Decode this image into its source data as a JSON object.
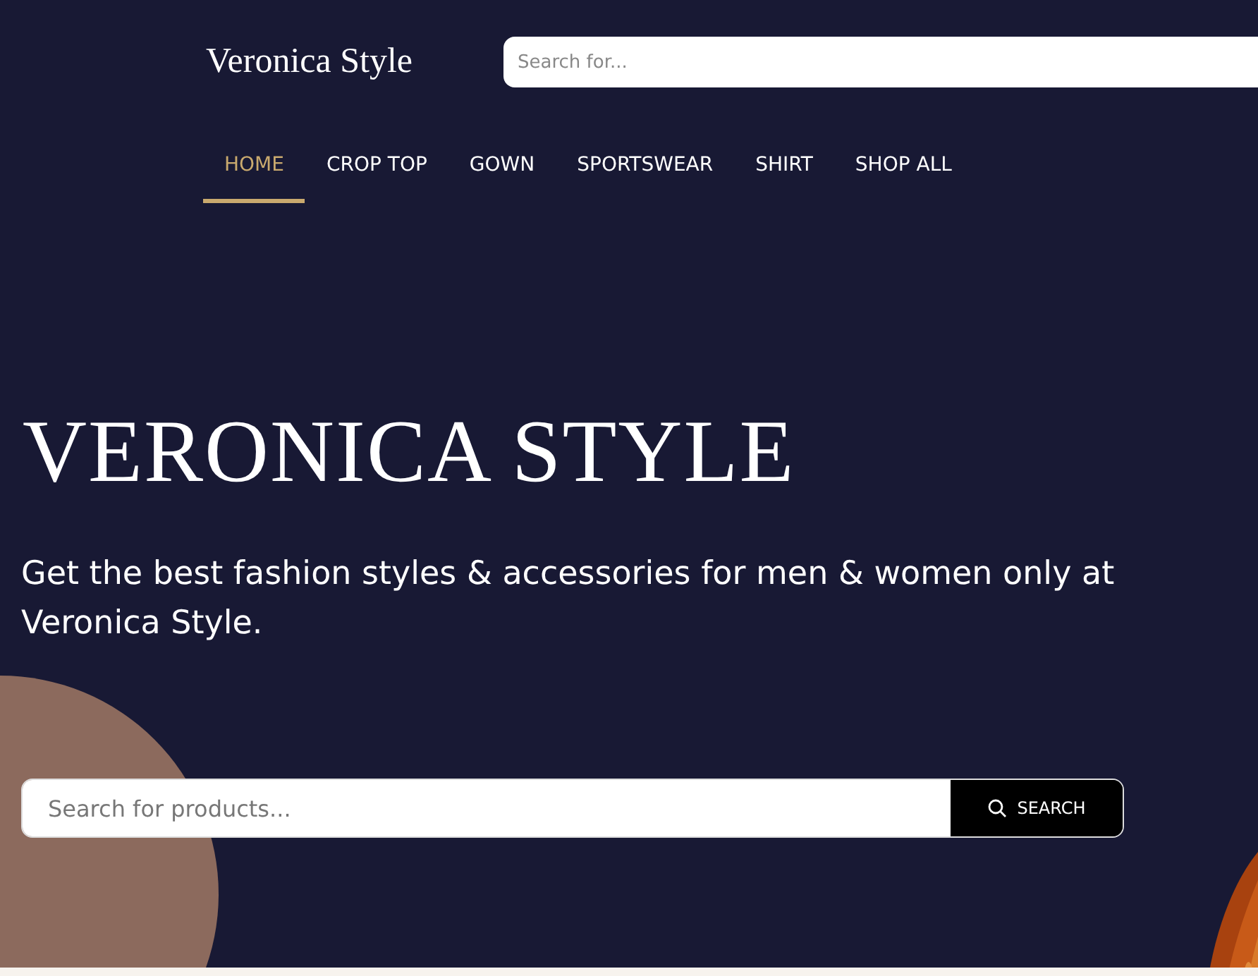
{
  "header": {
    "logo": "Veronica Style",
    "search": {
      "placeholder": "Search for..."
    }
  },
  "nav": [
    {
      "label": "HOME",
      "selected": true
    },
    {
      "label": "CROP TOP",
      "selected": false
    },
    {
      "label": "GOWN",
      "selected": false
    },
    {
      "label": "SPORTSWEAR",
      "selected": false
    },
    {
      "label": "SHIRT",
      "selected": false
    },
    {
      "label": "SHOP ALL",
      "selected": false
    }
  ],
  "hero": {
    "title": "VERONICA STYLE",
    "subtitle": "Get the best fashion styles & accessories for men & women only at Veronica Style.",
    "search": {
      "placeholder": "Search for products...",
      "button": "SEARCH"
    }
  }
}
